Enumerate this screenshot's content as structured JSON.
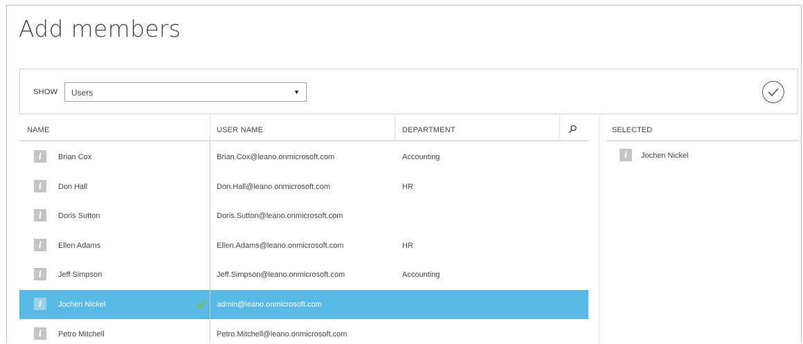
{
  "dialog": {
    "title": "Add members"
  },
  "filter": {
    "show_label": "SHOW",
    "selected": "Users"
  },
  "table": {
    "headers": {
      "name": "NAME",
      "user_name": "USER NAME",
      "department": "DEPARTMENT"
    },
    "rows": [
      {
        "name": "Brian Cox",
        "user_name": "Brian.Cox@leano.onmicrosoft.com",
        "department": "Accounting",
        "selected": false
      },
      {
        "name": "Don Hall",
        "user_name": "Don.Hall@leano.onmicrosoft.com",
        "department": "HR",
        "selected": false
      },
      {
        "name": "Doris Sutton",
        "user_name": "Doris.Sutton@leano.onmicrosoft.com",
        "department": "",
        "selected": false
      },
      {
        "name": "Ellen Adams",
        "user_name": "Ellen.Adams@leano.onmicrosoft.com",
        "department": "HR",
        "selected": false
      },
      {
        "name": "Jeff Simpson",
        "user_name": "Jeff.Simpson@leano.onmicrosoft.com",
        "department": "Accounting",
        "selected": false
      },
      {
        "name": "Jochen Nickel",
        "user_name": "admin@leano.onmicrosoft.com",
        "department": "",
        "selected": true
      },
      {
        "name": "Petro Mitchell",
        "user_name": "Petro.Mitchell@leano.onmicrosoft.com",
        "department": "",
        "selected": false
      }
    ]
  },
  "selected_panel": {
    "header": "SELECTED",
    "items": [
      {
        "name": "Jochen Nickel"
      }
    ]
  },
  "icons": {
    "info": "i",
    "confirm": "check-circle-icon",
    "search": "search-icon",
    "dropdown": "▼"
  },
  "colors": {
    "selected_row": "#58b9e5",
    "info_icon": "#c4c4c4",
    "check": "#7cc03a"
  }
}
